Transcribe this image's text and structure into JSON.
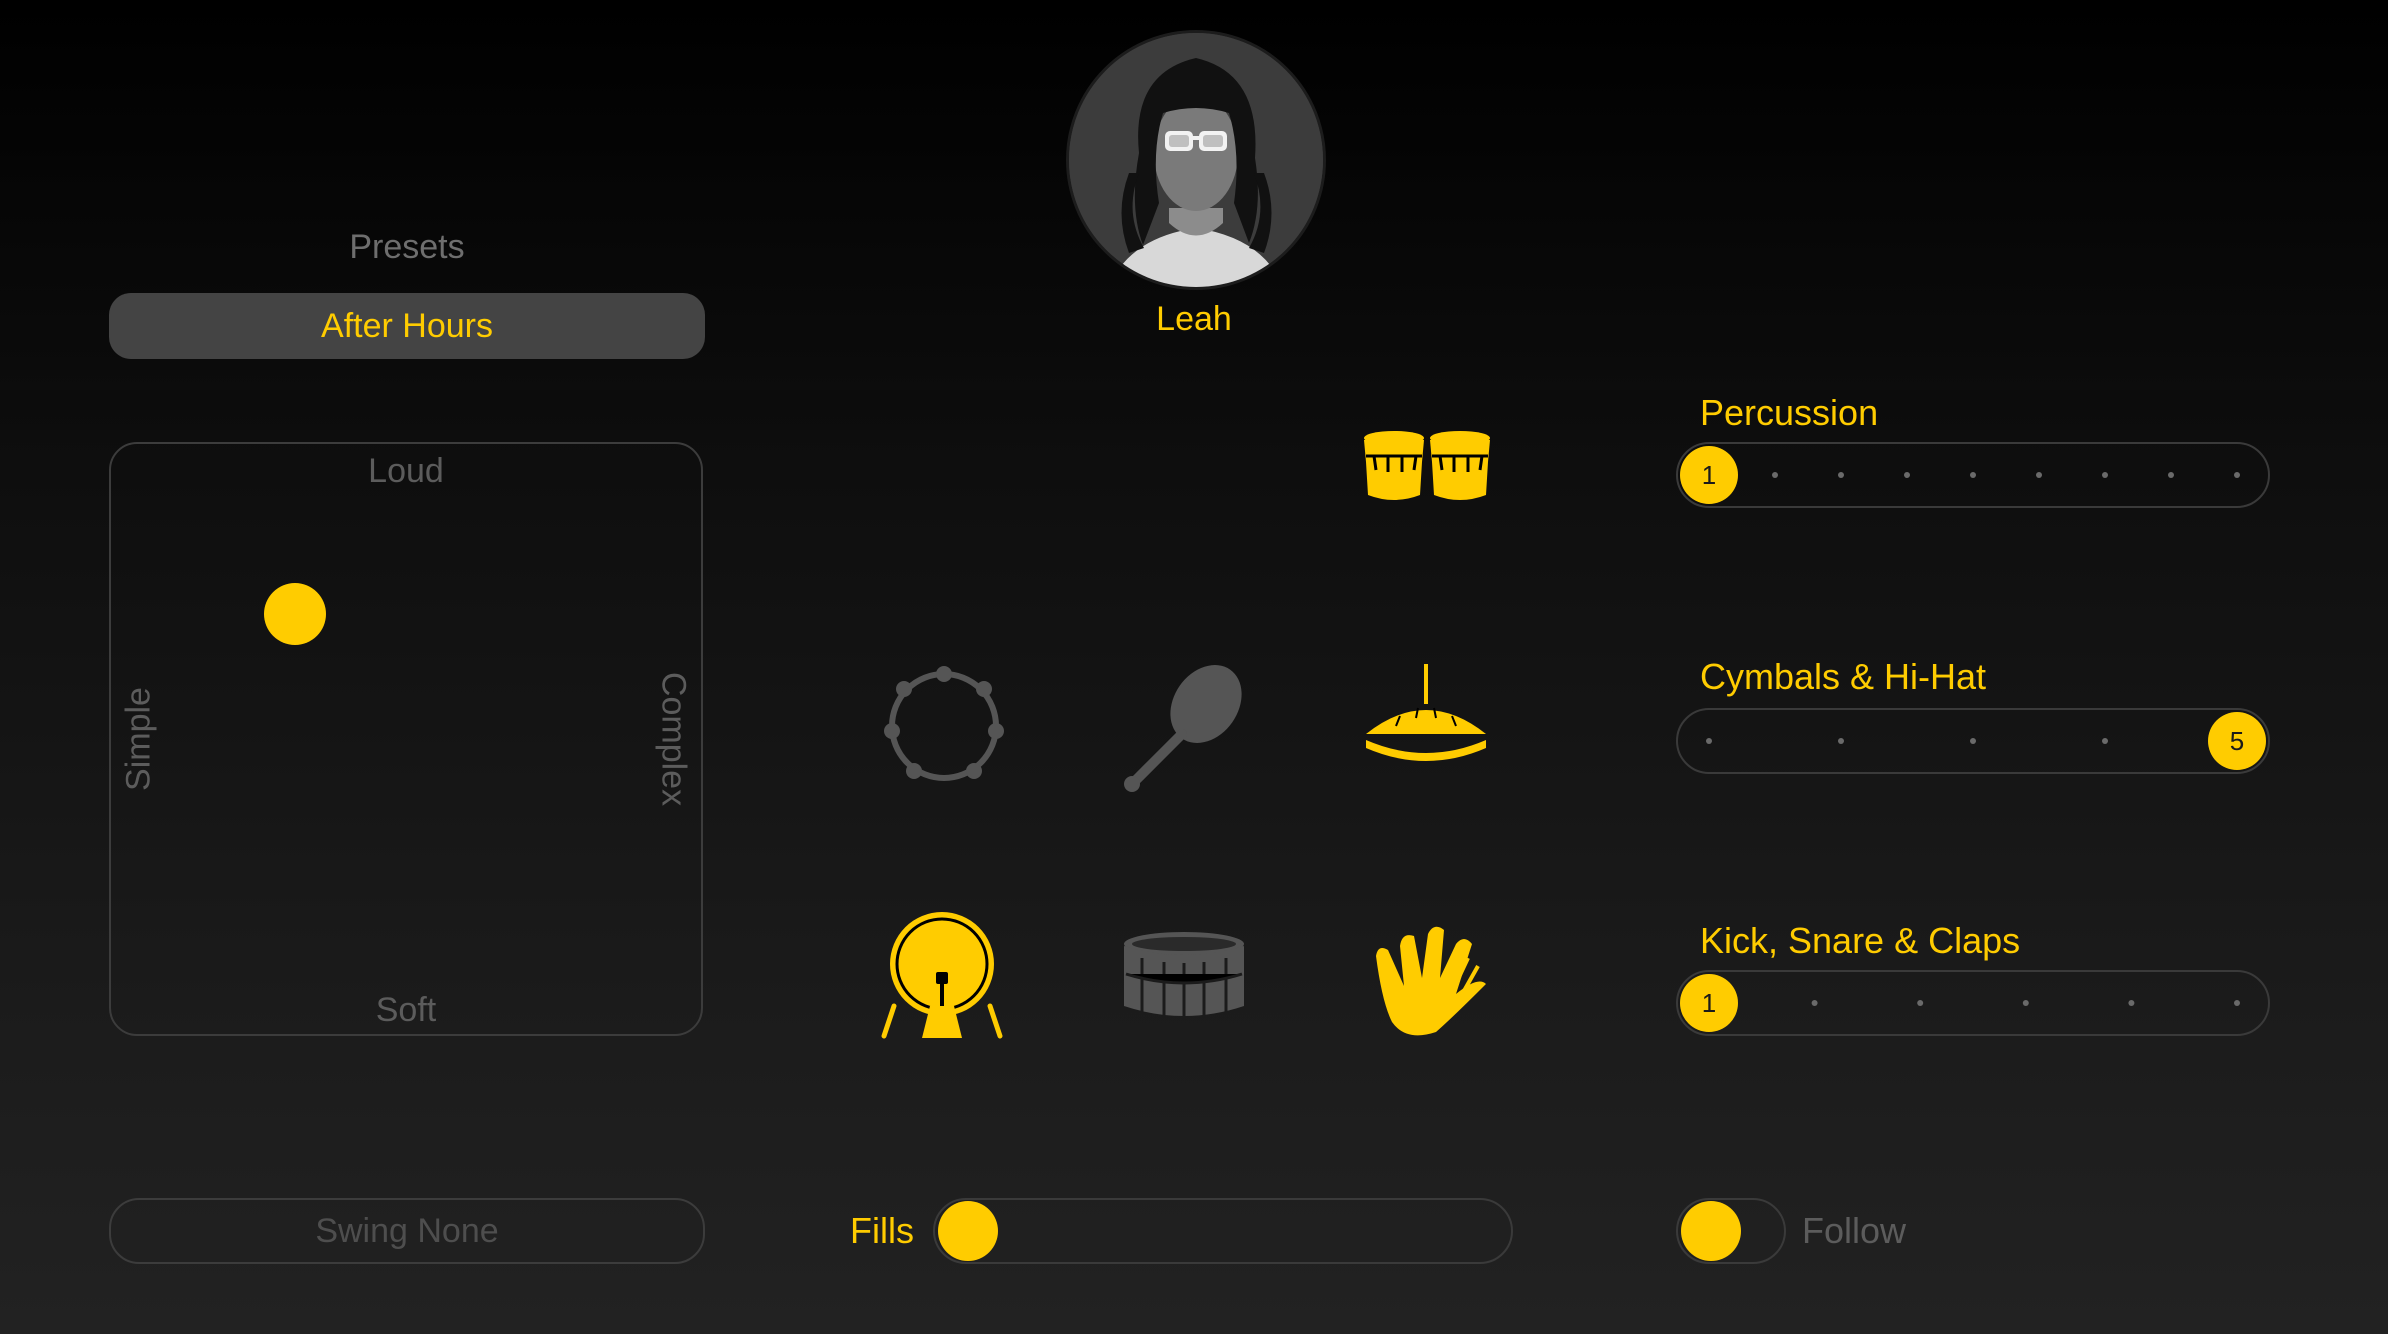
{
  "drummer": {
    "name": "Leah"
  },
  "presets": {
    "label": "Presets",
    "selected": "After Hours"
  },
  "xy_pad": {
    "top": "Loud",
    "bottom": "Soft",
    "left": "Simple",
    "right": "Complex"
  },
  "swing": {
    "label": "Swing None"
  },
  "instruments": [
    {
      "name": "bongos-icon",
      "active": true
    },
    {
      "name": "tambourine-icon",
      "active": false
    },
    {
      "name": "shaker-icon",
      "active": false
    },
    {
      "name": "hi-hat-icon",
      "active": true
    },
    {
      "name": "kick-drum-icon",
      "active": true
    },
    {
      "name": "snare-drum-icon",
      "active": false
    },
    {
      "name": "clap-icon",
      "active": true
    }
  ],
  "sliders": {
    "percussion": {
      "title": "Percussion",
      "value": "1",
      "steps": 9
    },
    "cymbals": {
      "title": "Cymbals & Hi-Hat",
      "value": "5",
      "steps": 5
    },
    "kick": {
      "title": "Kick, Snare & Claps",
      "value": "1",
      "steps": 6
    }
  },
  "fills": {
    "label": "Fills"
  },
  "follow": {
    "label": "Follow"
  },
  "colors": {
    "accent": "#ffcc00",
    "inactive": "#5a5a5a"
  }
}
